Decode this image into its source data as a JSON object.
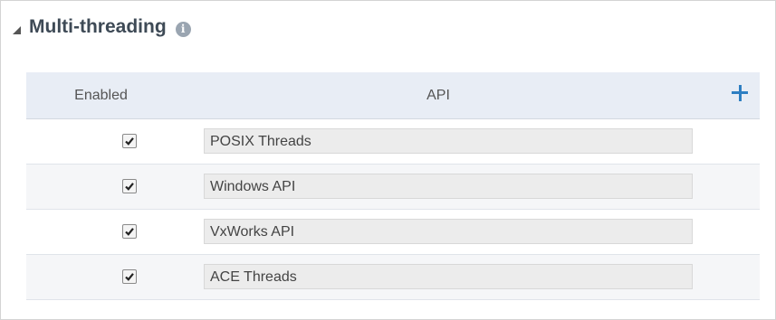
{
  "section": {
    "title": "Multi-threading",
    "info_icon": "info-icon",
    "collapse_icon": "collapse-triangle-icon"
  },
  "table": {
    "columns": [
      "Enabled",
      "API"
    ],
    "add_icon": "plus-icon",
    "rows": [
      {
        "enabled": true,
        "api": "POSIX Threads"
      },
      {
        "enabled": true,
        "api": "Windows API"
      },
      {
        "enabled": true,
        "api": "VxWorks API"
      },
      {
        "enabled": true,
        "api": "ACE Threads"
      }
    ]
  },
  "colors": {
    "header_bg": "#e8edf5",
    "accent": "#2e7fc2",
    "field_bg": "#ececec"
  }
}
